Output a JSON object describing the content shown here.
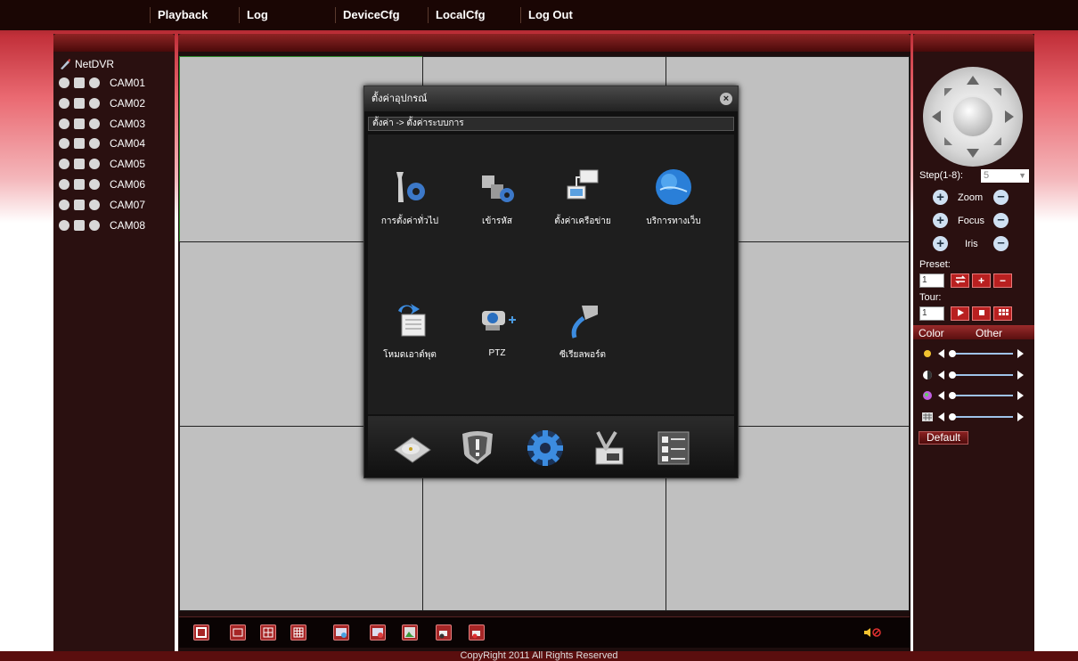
{
  "nav": {
    "items": [
      "Playback",
      "Log",
      "DeviceCfg",
      "LocalCfg",
      "Log Out"
    ]
  },
  "tree": {
    "root": "NetDVR",
    "cams": [
      "CAM01",
      "CAM02",
      "CAM03",
      "CAM04",
      "CAM05",
      "CAM06",
      "CAM07",
      "CAM08"
    ]
  },
  "dialog": {
    "title": "ตั้งค่าอุปกรณ์",
    "breadcrumb": "ตั้งค่า -> ตั้งค่าระบบการ",
    "items": [
      "การตั้งค่าทั่วไป",
      "เข้ารหัส",
      "ตั้งค่าเครือข่าย",
      "บริการทางเว็บ",
      "โหมดเอาต์พุต",
      "PTZ",
      "ซีเรียลพอร์ต"
    ],
    "close": "×"
  },
  "ptz": {
    "step_label": "Step(1-8):",
    "step_value": "5",
    "zoom": "Zoom",
    "focus": "Focus",
    "iris": "Iris",
    "preset_label": "Preset:",
    "preset_value": "1",
    "tour_label": "Tour:",
    "tour_value": "1"
  },
  "tabs": {
    "color": "Color",
    "other": "Other"
  },
  "default_label": "Default",
  "footer": "CopyRight 2011 All Rights Reserved",
  "colors": {
    "accent": "#a62626",
    "selected_cell_border": "#2e8a2e"
  }
}
